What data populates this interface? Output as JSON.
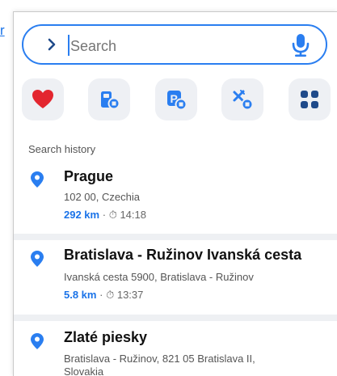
{
  "outer_link": "r",
  "search": {
    "placeholder": "Search"
  },
  "quick_actions": [
    {
      "name": "favorites",
      "icon": "heart-icon"
    },
    {
      "name": "fuel",
      "icon": "fuel-pump-icon"
    },
    {
      "name": "parking",
      "icon": "parking-icon"
    },
    {
      "name": "restaurants",
      "icon": "fork-knife-icon"
    },
    {
      "name": "more",
      "icon": "grid-icon"
    }
  ],
  "history": {
    "title": "Search history",
    "items": [
      {
        "title": "Prague",
        "subtitle": "102 00, Czechia",
        "distance": "292 km",
        "time": "14:18"
      },
      {
        "title": "Bratislava - Ružinov Ivanská cesta",
        "subtitle": "Ivanská cesta 5900, Bratislava - Ružinov",
        "distance": "5.8 km",
        "time": "13:37"
      },
      {
        "title": "Zlaté piesky",
        "subtitle": "Bratislava - Ružinov, 821 05 Bratislava II,",
        "subtitle2": "Slovakia"
      }
    ]
  },
  "colors": {
    "accent": "#1a73e8",
    "heart": "#e3262f",
    "icon_blue": "#2a7ef0",
    "chip_bg": "#eef0f4"
  },
  "meta_separator": "·",
  "clock_glyph": "⏱"
}
